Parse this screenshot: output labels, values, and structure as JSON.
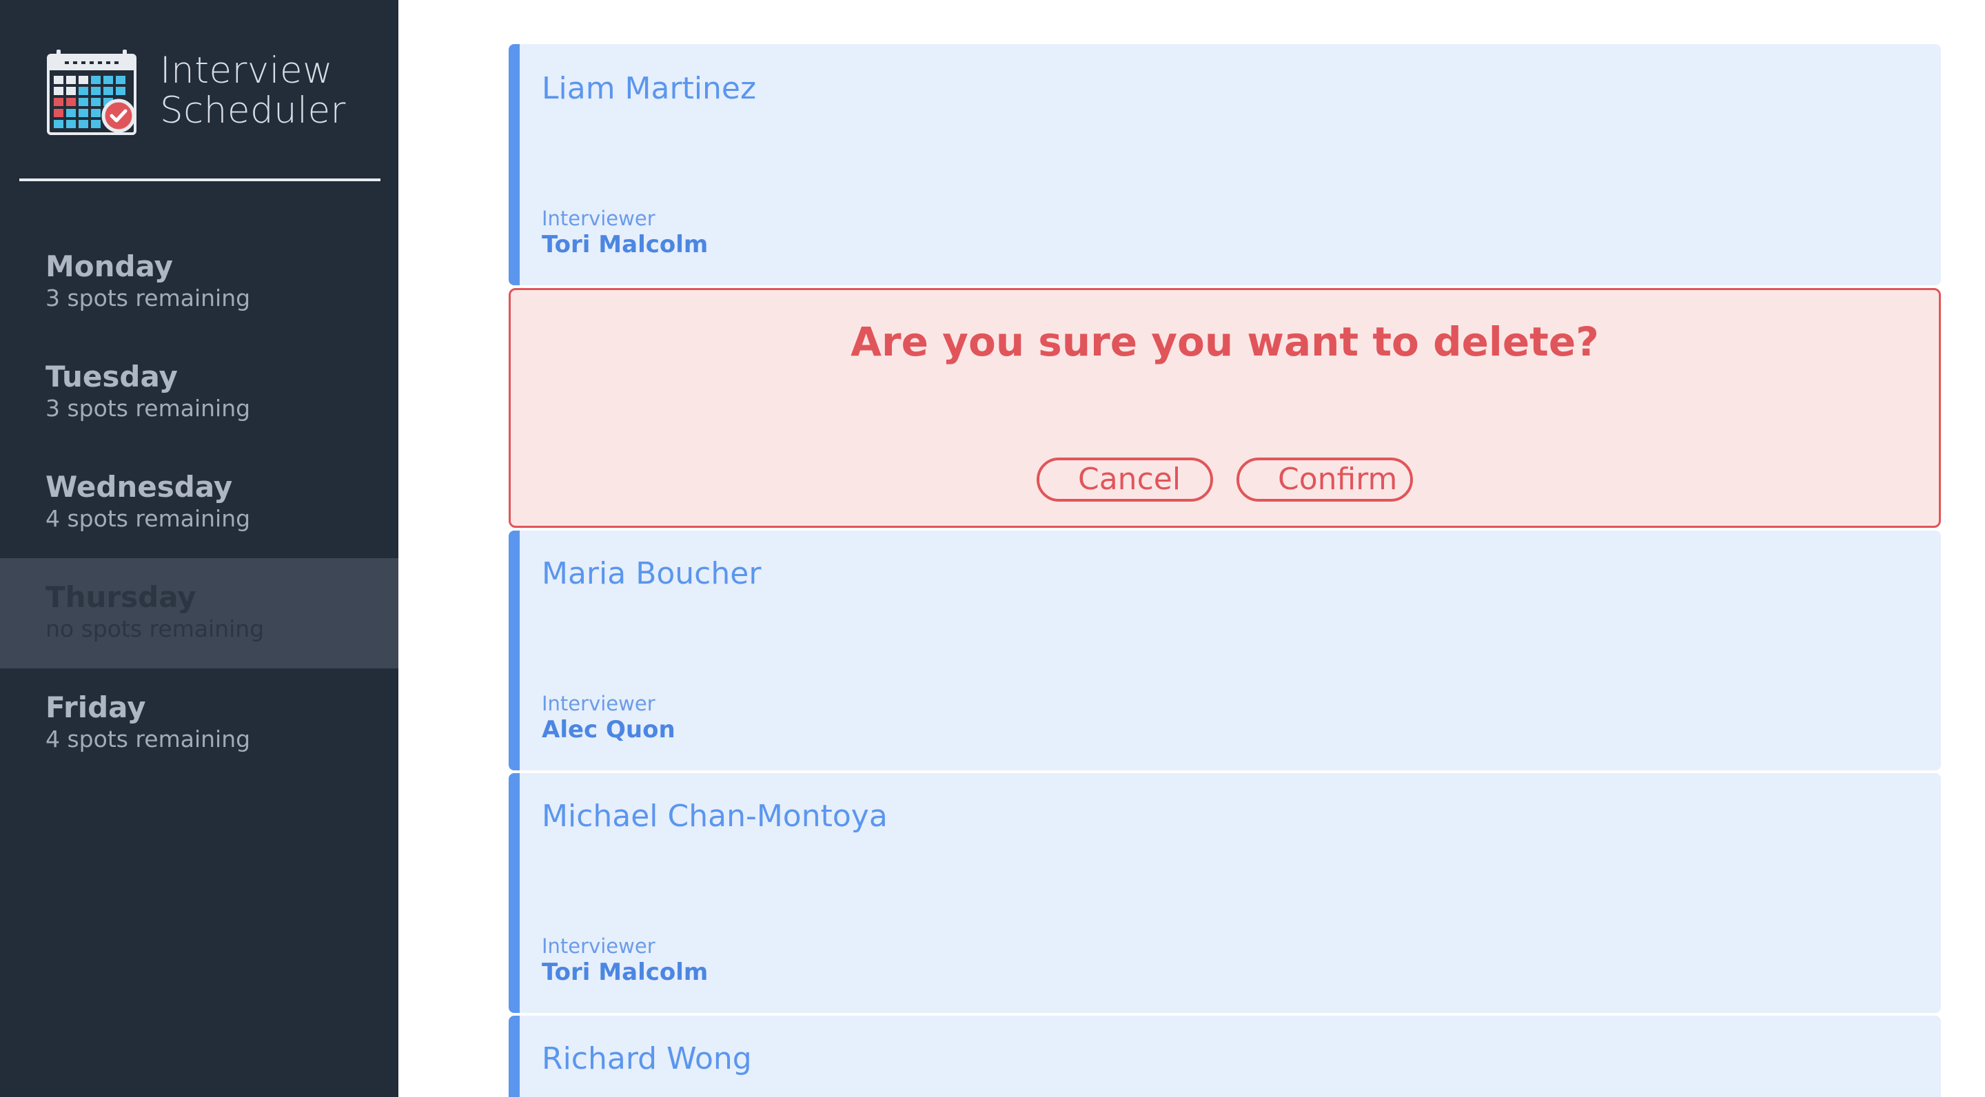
{
  "app": {
    "title_line1": "Interview",
    "title_line2": "Scheduler"
  },
  "days": [
    {
      "name": "Monday",
      "spots": "3 spots remaining"
    },
    {
      "name": "Tuesday",
      "spots": "3 spots remaining"
    },
    {
      "name": "Wednesday",
      "spots": "4 spots remaining"
    },
    {
      "name": "Thursday",
      "spots": "no spots remaining"
    },
    {
      "name": "Friday",
      "spots": "4 spots remaining"
    }
  ],
  "selected_day": "Thursday",
  "appointments": [
    {
      "student": "Liam Martinez",
      "interviewer_label": "Interviewer",
      "interviewer": "Tori Malcolm"
    },
    {
      "student": "Maria Boucher",
      "interviewer_label": "Interviewer",
      "interviewer": "Alec Quon"
    },
    {
      "student": "Michael Chan-Montoya",
      "interviewer_label": "Interviewer",
      "interviewer": "Tori Malcolm"
    },
    {
      "student": "Richard Wong"
    }
  ],
  "confirm_dialog": {
    "message": "Are you sure you want to delete?",
    "cancel_label": "Cancel",
    "confirm_label": "Confirm"
  },
  "colors": {
    "sidebar_bg": "#232c39",
    "selected_bg": "#3e4755",
    "card_bg": "#e6effc",
    "accent_blue": "#5a96ee",
    "danger": "#e0555a",
    "danger_bg": "#fbe6e6"
  },
  "icons": {
    "logo": "calendar-check-icon"
  }
}
